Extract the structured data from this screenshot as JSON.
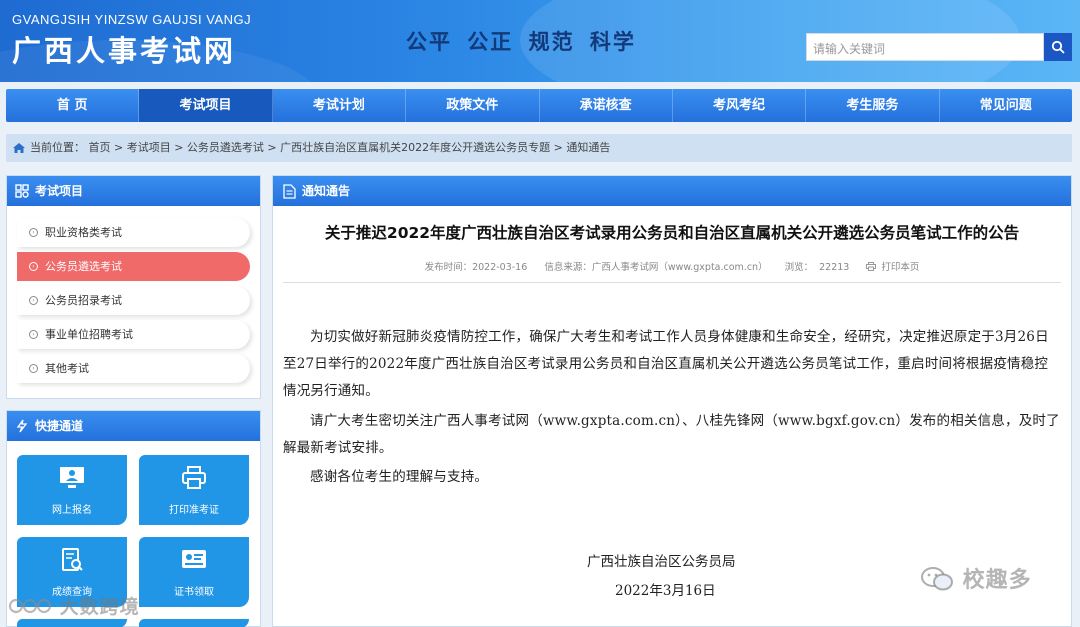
{
  "header": {
    "logo_en": "GVANGJSIH YINZSW GAUJSI VANGJ",
    "logo_cn": "广西人事考试网",
    "slogan": "公平  公正  规范  科学",
    "search_placeholder": "请输入关键词"
  },
  "nav": {
    "items": [
      "首 页",
      "考试项目",
      "考试计划",
      "政策文件",
      "承诺核查",
      "考风考纪",
      "考生服务",
      "常见问题"
    ],
    "active_index": 1
  },
  "breadcrumb": "当前位置： 首页 > 考试项目 > 公务员遴选考试 > 广西壮族自治区直属机关2022年度公开遴选公务员专题 > 通知通告",
  "sidebar": {
    "exam_title": "考试项目",
    "exam_items": [
      "职业资格类考试",
      "公务员遴选考试",
      "公务员招录考试",
      "事业单位招聘考试",
      "其他考试"
    ],
    "active_index": 1,
    "quick_title": "快捷通道",
    "quick_tiles": [
      "网上报名",
      "打印准考证",
      "成绩查询",
      "证书领取"
    ]
  },
  "main": {
    "section_title": "通知通告",
    "title": "关于推迟2022年度广西壮族自治区考试录用公务员和自治区直属机关公开遴选公务员笔试工作的公告",
    "meta_date": "发布时间：2022-03-16",
    "meta_source": "信息来源：广西人事考试网（www.gxpta.com.cn）",
    "meta_views_label": "浏览：",
    "meta_views": "22213",
    "meta_print": "打印本页",
    "paragraphs": [
      "为切实做好新冠肺炎疫情防控工作，确保广大考生和考试工作人员身体健康和生命安全，经研究，决定推迟原定于3月26日至27日举行的2022年度广西壮族自治区考试录用公务员和自治区直属机关公开遴选公务员笔试工作，重启时间将根据疫情稳控情况另行通知。",
      "请广大考生密切关注广西人事考试网（www.gxpta.com.cn）、八桂先锋网（www.bgxf.gov.cn）发布的相关信息，及时了解最新考试安排。",
      "感谢各位考生的理解与支持。"
    ],
    "sign_org": "广西壮族自治区公务员局",
    "sign_date": "2022年3月16日"
  },
  "watermarks": {
    "left": "大数跨境",
    "right": "校趣多"
  }
}
